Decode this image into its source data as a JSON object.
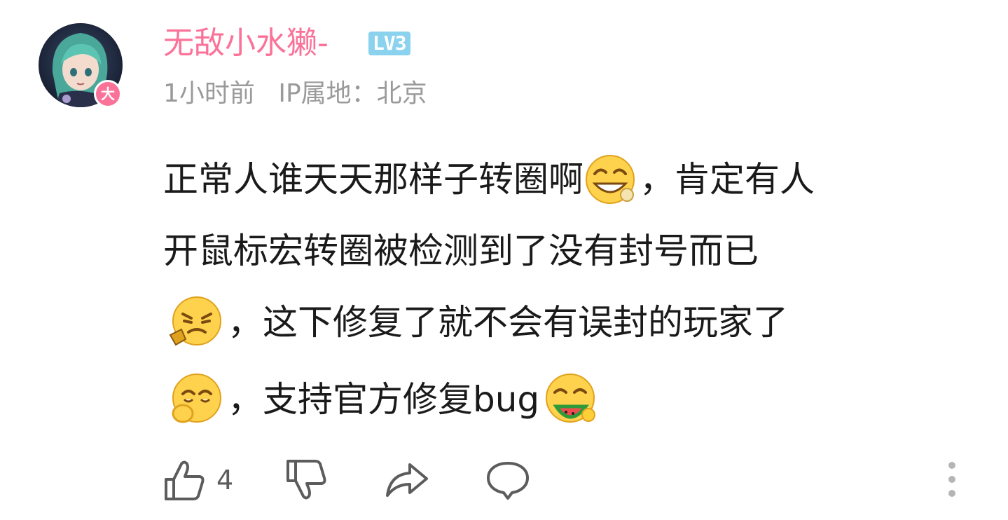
{
  "comment": {
    "user": {
      "name": "无敌小水獭-",
      "level": "LV3",
      "badge": "大",
      "name_color": "#fb7299"
    },
    "meta": {
      "time": "1小时前",
      "ip_location": "IP属地：北京"
    },
    "body": {
      "line1_a": "正常人谁天天那样子转圈啊",
      "line1_b": "，肯定有人",
      "line2": "开鼠标宏转圈被检测到了没有封号而已",
      "line3": "，这下修复了就不会有误封的玩家了",
      "line4": "，支持官方修复bug"
    },
    "emojis": [
      "grin-emoji-icon",
      "angry-emoji-icon",
      "snicker-emoji-icon",
      "watermelon-emoji-icon"
    ],
    "actions": {
      "like_icon": "thumbs-up-icon",
      "like_count": "4",
      "dislike_icon": "thumbs-down-icon",
      "share_icon": "share-icon",
      "reply_icon": "comment-icon",
      "more_icon": "more-vertical-icon"
    }
  }
}
